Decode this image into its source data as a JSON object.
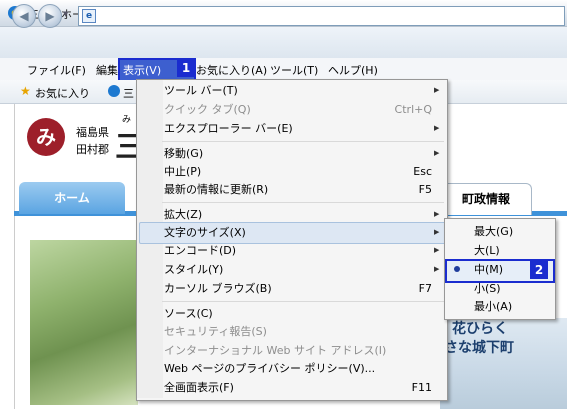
{
  "window": {
    "title": "三春町ホームページ トップページ - Windows Internet Explorer"
  },
  "menubar": {
    "file": "ファイル(F)",
    "edit": "編集(E)",
    "view": "表示(V)",
    "favorites": "お気に入り(A)",
    "tools": "ツール(T)",
    "help": "ヘルプ(H)"
  },
  "favbar": {
    "favorites": "お気に入り",
    "tab_partial": "三"
  },
  "badges": {
    "one": "1",
    "two": "2"
  },
  "page": {
    "pref": "福島県",
    "district": "田村郡",
    "town_char": "三",
    "small_kana": "み",
    "home_tab": "ホーム",
    "gov_tab": "町政情報",
    "caption1": "花ひらく",
    "caption2": "さな城下町",
    "logo_glyph": "み"
  },
  "view_menu": {
    "toolbars": "ツール バー(T)",
    "quick_tabs": "クイック タブ(Q)",
    "quick_tabs_shortcut": "Ctrl+Q",
    "explorer_bar": "エクスプローラー バー(E)",
    "go_to": "移動(G)",
    "stop": "中止(P)",
    "stop_shortcut": "Esc",
    "refresh": "最新の情報に更新(R)",
    "refresh_shortcut": "F5",
    "zoom": "拡大(Z)",
    "text_size": "文字のサイズ(X)",
    "encoding": "エンコード(D)",
    "style": "スタイル(Y)",
    "caret_browsing": "カーソル ブラウズ(B)",
    "caret_shortcut": "F7",
    "source": "ソース(C)",
    "security_report": "セキュリティ報告(S)",
    "intl_address": "インターナショナル Web サイト アドレス(I)",
    "privacy_policy": "Web ページのプライバシー ポリシー(V)...",
    "full_screen": "全画面表示(F)",
    "full_screen_shortcut": "F11"
  },
  "text_size_menu": {
    "largest": "最大(G)",
    "larger": "大(L)",
    "medium": "中(M)",
    "smaller": "小(S)",
    "smallest": "最小(A)",
    "selected": "中(M)"
  },
  "icons": {
    "back": "back-arrow-icon",
    "forward": "forward-arrow-icon",
    "favorites_star": "star-icon",
    "submenu": "submenu-arrow-icon",
    "radio": "radio-selected-icon"
  },
  "colors": {
    "highlight_box": "#1a2ccf",
    "logo": "#9d1f2a",
    "nav_blue": "#3f92d9"
  }
}
